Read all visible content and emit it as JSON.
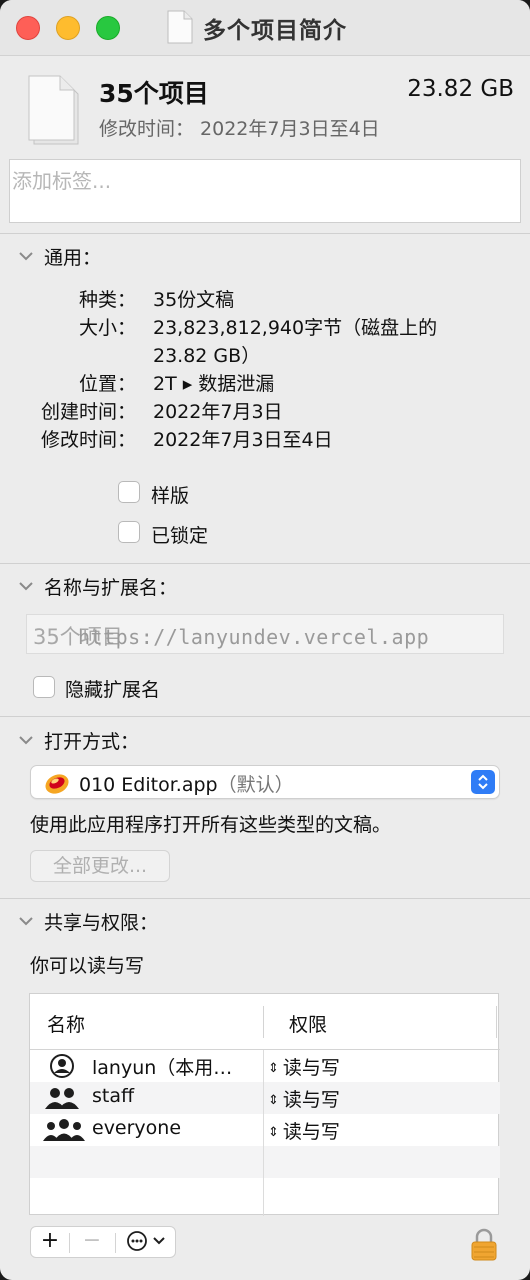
{
  "window": {
    "title": "多个项目简介"
  },
  "summary": {
    "name": "35个项目",
    "size": "23.82 GB",
    "modified": "修改时间： 2022年7月3日至4日"
  },
  "tags": {
    "placeholder": "添加标签..."
  },
  "general": {
    "heading": "通用：",
    "kind_label": "种类：",
    "kind_value": "35份文稿",
    "size_label": "大小：",
    "size_value_line1": "23,823,812,940字节（磁盘上的",
    "size_value_line2": "23.82 GB）",
    "where_label": "位置：",
    "where_value": "2T ▸ 数据泄漏",
    "created_label": "创建时间：",
    "created_value": "2022年7月3日",
    "modified_label": "修改时间：",
    "modified_value": "2022年7月3日至4日",
    "stationery_label": "样版",
    "locked_label": "已锁定"
  },
  "name_ext": {
    "heading": "名称与扩展名：",
    "field_value": "35个项目",
    "watermark": "https://lanyundev.vercel.app",
    "hide_ext_label": "隐藏扩展名"
  },
  "open_with": {
    "heading": "打开方式：",
    "app_name": "010 Editor.app",
    "app_default": "（默认）",
    "description": "使用此应用程序打开所有这些类型的文稿。",
    "change_all_label": "全部更改..."
  },
  "sharing": {
    "heading": "共享与权限：",
    "description": "你可以读与写",
    "col_name": "名称",
    "col_privilege": "权限",
    "rows": [
      {
        "name": "lanyun（本用…",
        "privilege": "读与写",
        "icon": "single-user-icon"
      },
      {
        "name": "staff",
        "privilege": "读与写",
        "icon": "group-icon"
      },
      {
        "name": "everyone",
        "privilege": "读与写",
        "icon": "everyone-icon"
      }
    ],
    "add_label": "+",
    "remove_label": "−"
  },
  "colors": {
    "close": "#fe5f57",
    "minimize": "#febc2e",
    "zoom": "#28c840",
    "accent": "#2f7cf6",
    "lock": "#f0a531"
  }
}
